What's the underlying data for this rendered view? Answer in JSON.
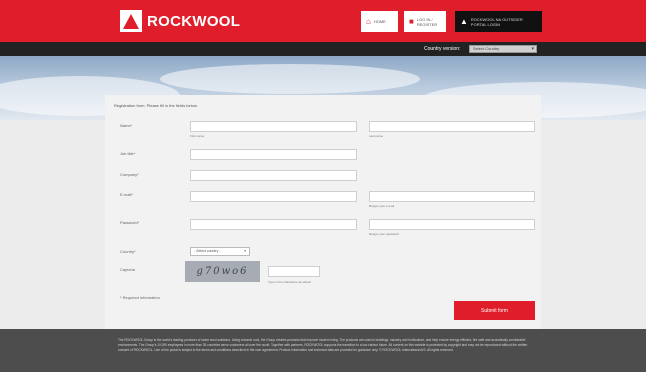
{
  "header": {
    "logo_text": "ROCKWOOL",
    "home_label": "HOME",
    "secure_label": "LOG IN / REGISTER",
    "user_label": "ROCKWOOL NA OUTSIDER PORTAL LOGIN"
  },
  "country": {
    "label": "Country version:",
    "selected": "Select Country"
  },
  "form": {
    "intro": "Registration form. Please fill in the fields below.",
    "first_name_label": "Name*",
    "first_name_hint": "First name",
    "last_name_hint": "Last name",
    "job_title_label": "Job title*",
    "company_label": "Company*",
    "email_label": "E-mail*",
    "email_hint": "Retype your e-mail",
    "password_label": "Password*",
    "password_hint": "Retype your password",
    "country_label": "Country*",
    "country_select": "- Select country -",
    "captcha_label": "Captcha",
    "captcha_text": "g70wo6",
    "captcha_hint": "Type in the characters as shown",
    "required_note": "* Required information",
    "submit_label": "Submit form"
  },
  "footer": {
    "legal": "The ROCKWOOL Group is the world's leading producer of stone wool solutions. Using volcanic rock, the Group creates products that improve modern living. The products are used in buildings, industry and horticulture, and help ensure energy efficient, fire safe and acoustically comfortable environments. The Group's 10,000 employees in more than 35 countries serve customers all over the world. Together with partners, ROCKWOOL supports the transition to a low carbon future. All content on this website is protected by copyright and may not be reproduced without the written consent of ROCKWOOL. Use of the portal is subject to the terms and conditions described in the user agreement. Product information and technical data are provided for guidance only. © ROCKWOOL International A/S. All rights reserved."
  },
  "colors": {
    "brand_red": "#e01e2b",
    "dark_bar": "#222222",
    "footer": "#4d4d4d"
  }
}
